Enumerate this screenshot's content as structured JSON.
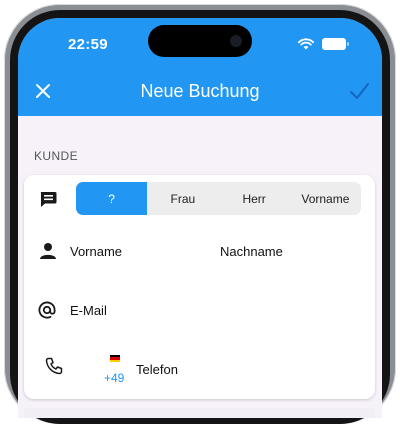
{
  "status_bar": {
    "time": "22:59"
  },
  "app_bar": {
    "title": "Neue Buchung",
    "close_icon": "close-icon",
    "confirm_icon": "check-icon",
    "color": "#2196f3"
  },
  "section": {
    "label": "KUNDE"
  },
  "salutation": {
    "icon": "chat-bubble-icon",
    "options": [
      "?",
      "Frau",
      "Herr",
      "Vorname"
    ],
    "selected": "?"
  },
  "name": {
    "icon": "person-icon",
    "first_name_placeholder": "Vorname",
    "last_name_placeholder": "Nachname"
  },
  "email": {
    "icon": "at-icon",
    "placeholder": "E-Mail"
  },
  "phone": {
    "icon": "phone-icon",
    "country_flag": "de-flag-icon",
    "dial_code": "+49",
    "placeholder": "Telefon"
  }
}
